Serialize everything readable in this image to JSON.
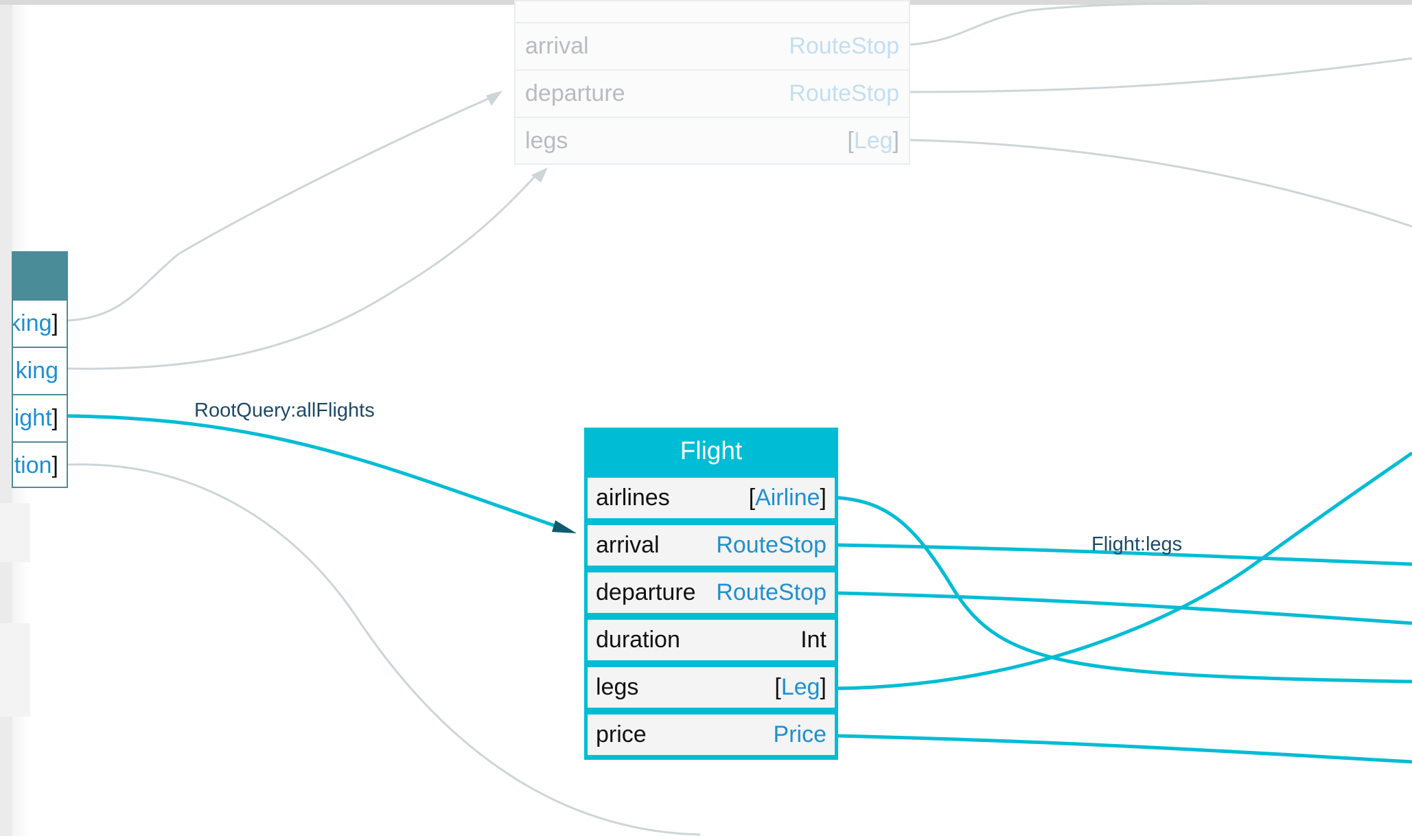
{
  "colors": {
    "accent": "#00bcd4",
    "root_header": "#4b8c99",
    "type_link": "#1f8fd1",
    "faded_edge": "#ccd5d8",
    "label_text": "#1e4a66"
  },
  "faded_node": {
    "fields": [
      {
        "name": "arrival",
        "type": "RouteStop",
        "list": false
      },
      {
        "name": "departure",
        "type": "RouteStop",
        "list": false
      },
      {
        "name": "legs",
        "type": "Leg",
        "list": true
      }
    ]
  },
  "root_node": {
    "fields": [
      {
        "type": "king",
        "list": true
      },
      {
        "type": "king",
        "list": false
      },
      {
        "type": "ight",
        "list": true
      },
      {
        "type": "tion",
        "list": true
      }
    ]
  },
  "flight": {
    "title": "Flight",
    "fields": [
      {
        "name": "airlines",
        "type": "Airline",
        "list": true,
        "scalar": false
      },
      {
        "name": "arrival",
        "type": "RouteStop",
        "list": false,
        "scalar": false
      },
      {
        "name": "departure",
        "type": "RouteStop",
        "list": false,
        "scalar": false
      },
      {
        "name": "duration",
        "type": "Int",
        "list": false,
        "scalar": true
      },
      {
        "name": "legs",
        "type": "Leg",
        "list": true,
        "scalar": false
      },
      {
        "name": "price",
        "type": "Price",
        "list": false,
        "scalar": false
      }
    ]
  },
  "edge_labels": {
    "root_all_flights": "RootQuery:allFlights",
    "flight_legs": "Flight:legs"
  }
}
